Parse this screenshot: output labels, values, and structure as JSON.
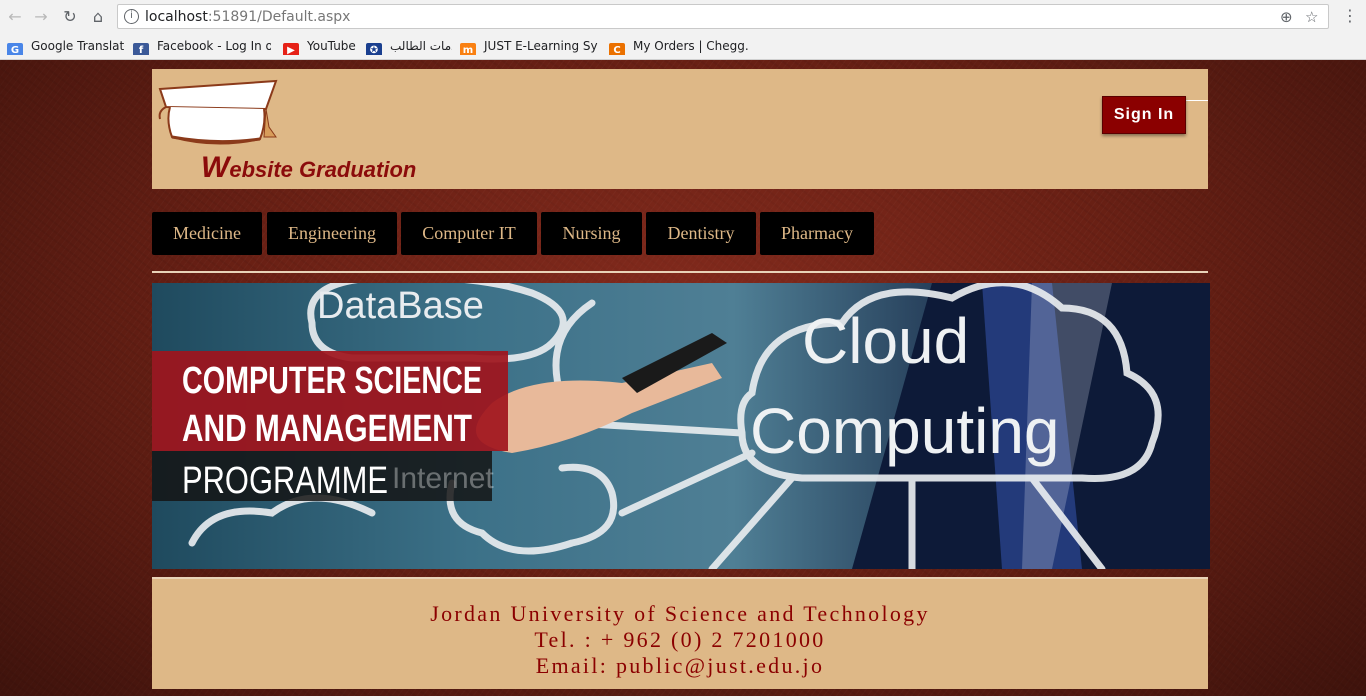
{
  "browser": {
    "url_host": "localhost",
    "url_rest": ":51891/Default.aspx",
    "back_icon": "arrow-left-icon",
    "forward_icon": "arrow-right-icon",
    "reload_icon": "reload-icon",
    "home_icon": "home-icon",
    "bookmarks": [
      {
        "label": "Google Translate",
        "icon": "google-translate-icon",
        "color": "#4a86e8"
      },
      {
        "label": "Facebook - Log In or",
        "icon": "facebook-icon",
        "color": "#3b5998"
      },
      {
        "label": "YouTube",
        "icon": "youtube-icon",
        "color": "#e62117"
      },
      {
        "label": "خدمات الطالب",
        "icon": "university-seal-icon",
        "color": "#1a3f8f"
      },
      {
        "label": "JUST E-Learning Syste",
        "icon": "moodle-icon",
        "color": "#f98012"
      },
      {
        "label": "My Orders | Chegg.cc",
        "icon": "chegg-icon",
        "color": "#eb7100"
      }
    ]
  },
  "site": {
    "logo_text_first": "W",
    "logo_text_rest": "ebsite Graduation",
    "signin_label": "Sign In",
    "menu": [
      "Medicine",
      "Engineering",
      "Computer IT",
      "Nursing",
      "Dentistry",
      "Pharmacy"
    ],
    "banner": {
      "line1": "COMPUTER SCIENCE",
      "line2": "AND MANAGEMENT",
      "line3": "PROGRAMME",
      "cloud_word1": "Cloud",
      "cloud_word2": "Computing",
      "bg_word": "DataBase",
      "bg_word2": "Internet"
    },
    "footer": {
      "line1": "Jordan University of Science and Technology",
      "line2": "Tel. : + 962 (0) 2 7201000",
      "line3": "Email: public@just.edu.jo"
    },
    "colors": {
      "header_bg": "#deb887",
      "accent": "#8b0000",
      "menu_bg": "#000000",
      "menu_text": "#deb887"
    }
  }
}
